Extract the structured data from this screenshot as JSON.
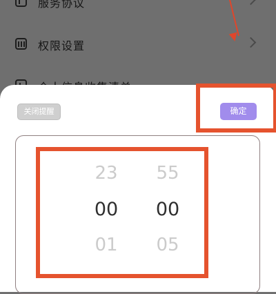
{
  "background_list": {
    "items": [
      {
        "label": "服务协议",
        "icon": "document-icon"
      },
      {
        "label": "权限设置",
        "icon": "permission-icon"
      },
      {
        "label": "个人信息收集清单",
        "icon": "list-icon"
      }
    ]
  },
  "sheet": {
    "close_reminder_label": "关闭提醒",
    "confirm_label": "确定"
  },
  "picker": {
    "hour": {
      "prev": "23",
      "current": "00",
      "next": "01"
    },
    "minute": {
      "prev": "55",
      "current": "00",
      "next": "05"
    }
  },
  "colors": {
    "accent": "#a18cec",
    "annotation": "#e5532e",
    "overlay": "#6f6f6f"
  }
}
